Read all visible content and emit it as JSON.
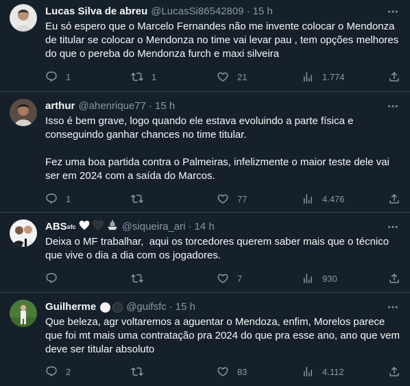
{
  "tweets": [
    {
      "name": "Lucas Silva de abreu",
      "handle": "@LucasSi86542809",
      "dot": "·",
      "time": "15 h",
      "text": "Eu só espero que o Marcelo Fernandes não me invente colocar o Mendonza de titular se colocar o Mendonza no time vai levar pau , tem opções melhores do que o pereba do Mendonza furch e maxi silveira",
      "replies": "1",
      "retweets": "1",
      "likes": "21",
      "views": "1.774"
    },
    {
      "name": "arthur",
      "handle": "@ahenrique77",
      "dot": "·",
      "time": "15 h",
      "text": "Isso é bem grave, logo quando ele estava evoluindo a parte física e conseguindo ganhar chances no time titular.\n\nFez uma boa partida contra o Palmeiras, infelizmente o maior teste dele vai ser em 2024 com a saída do Marcos.",
      "replies": "1",
      "retweets": "",
      "likes": "77",
      "views": "4.476"
    },
    {
      "name": "ABS",
      "name_sup": "sfc",
      "handle": "@siqueira_ari",
      "dot": "·",
      "time": "14 h",
      "text": "Deixa o MF trabalhar,  aqui os torcedores querem saber mais que o técnico que vive o dia a dia com os jogadores.",
      "replies": "",
      "retweets": "",
      "likes": "7",
      "views": "930"
    },
    {
      "name": "Guilherme",
      "handle": "@guifsfc",
      "dot": "·",
      "time": "15 h",
      "text": "Que beleza, agr voltaremos a aguentar o Mendoza, enfim, Morelos parece que foi mt mais uma contratação pra 2024 do que pra esse ano, ano que vem deve ser titular absoluto",
      "replies": "2",
      "retweets": "",
      "likes": "83",
      "views": "4.112"
    }
  ],
  "colors": {
    "background": "#15202b",
    "border": "#38444d",
    "text": "#f7f9f9",
    "secondary": "#8b98a5"
  },
  "icons": [
    "more-icon",
    "reply-icon",
    "retweet-icon",
    "like-icon",
    "views-icon",
    "share-icon"
  ]
}
